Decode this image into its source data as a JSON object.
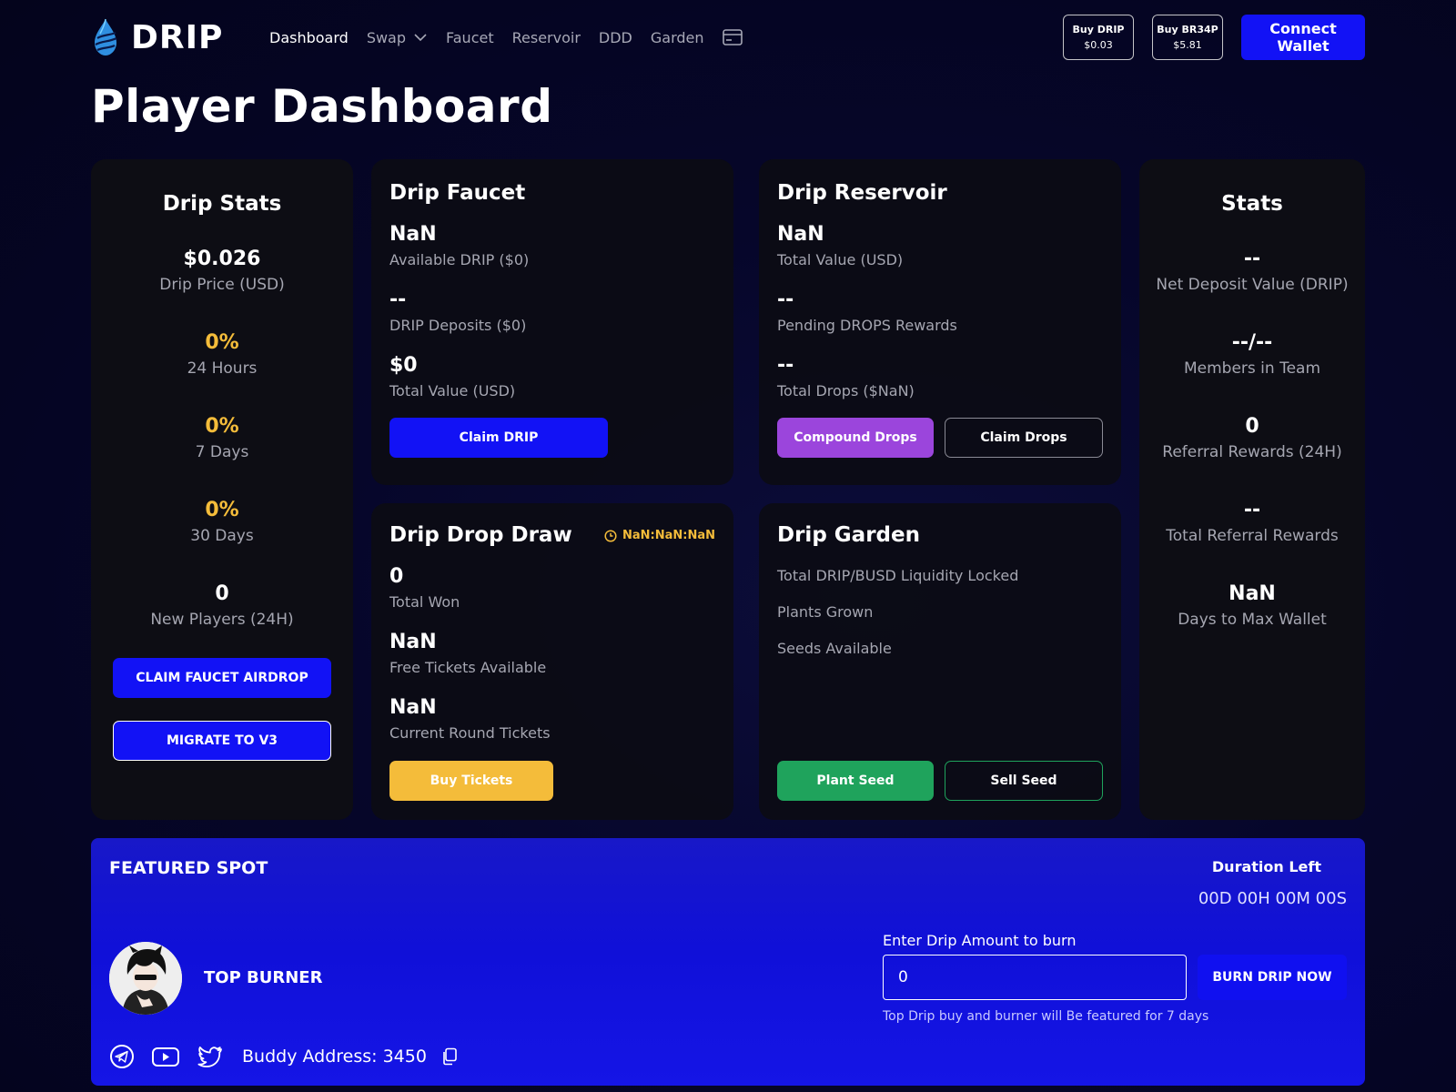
{
  "nav": {
    "brand": "DRIP",
    "links": [
      "Dashboard",
      "Swap",
      "Faucet",
      "Reservoir",
      "DDD",
      "Garden"
    ],
    "buy_drip": {
      "title": "Buy DRIP",
      "price": "$0.03"
    },
    "buy_br34p": {
      "title": "Buy BR34P",
      "price": "$5.81"
    },
    "connect": "Connect Wallet"
  },
  "page_title": "Player Dashboard",
  "drip_stats": {
    "title": "Drip Stats",
    "items": [
      {
        "value": "$0.026",
        "label": "Drip Price (USD)"
      },
      {
        "value": "0%",
        "label": "24 Hours"
      },
      {
        "value": "0%",
        "label": "7 Days"
      },
      {
        "value": "0%",
        "label": "30 Days"
      },
      {
        "value": "0",
        "label": "New Players (24H)"
      }
    ],
    "claim_airdrop": "CLAIM FAUCET AIRDROP",
    "migrate": "MIGRATE TO V3"
  },
  "faucet": {
    "title": "Drip Faucet",
    "items": [
      {
        "value": "NaN",
        "label": "Available DRIP ($0)"
      },
      {
        "value": "--",
        "label": "DRIP Deposits ($0)"
      },
      {
        "value": "$0",
        "label": "Total Value (USD)"
      }
    ],
    "claim": "Claim DRIP"
  },
  "reservoir": {
    "title": "Drip Reservoir",
    "items": [
      {
        "value": "NaN",
        "label": "Total Value (USD)"
      },
      {
        "value": "--",
        "label": "Pending DROPS Rewards"
      },
      {
        "value": "--",
        "label": "Total Drops ($NaN)"
      }
    ],
    "compound": "Compound Drops",
    "claim": "Claim Drops"
  },
  "stats": {
    "title": "Stats",
    "items": [
      {
        "value": "--",
        "label": "Net Deposit Value (DRIP)"
      },
      {
        "value": "--/--",
        "label": "Members in Team"
      },
      {
        "value": "0",
        "label": "Referral Rewards (24H)"
      },
      {
        "value": "--",
        "label": "Total Referral Rewards"
      },
      {
        "value": "NaN",
        "label": "Days to Max Wallet"
      }
    ]
  },
  "drop_draw": {
    "title": "Drip Drop Draw",
    "timer": "NaN:NaN:NaN",
    "items": [
      {
        "value": "0",
        "label": "Total Won"
      },
      {
        "value": "NaN",
        "label": "Free Tickets Available"
      },
      {
        "value": "NaN",
        "label": "Current Round Tickets"
      }
    ],
    "buy": "Buy Tickets"
  },
  "garden": {
    "title": "Drip Garden",
    "lines": [
      "Total DRIP/BUSD Liquidity Locked",
      "Plants Grown",
      "Seeds Available"
    ],
    "plant": "Plant Seed",
    "sell": "Sell Seed"
  },
  "featured": {
    "title": "FEATURED SPOT",
    "duration_label": "Duration Left",
    "duration_value": "00D 00H 00M 00S",
    "top_burner": "TOP BURNER",
    "burn_label": "Enter Drip Amount to burn",
    "burn_value": "0",
    "burn_button": "BURN DRIP NOW",
    "burn_note": "Top Drip buy and burner will Be featured for 7 days",
    "buddy": "Buddy Address: 3450"
  },
  "colors": {
    "accent_blue": "#1212f5",
    "yellow": "#f4bc3a",
    "purple": "#9b45dc",
    "green": "#1fa35c"
  }
}
